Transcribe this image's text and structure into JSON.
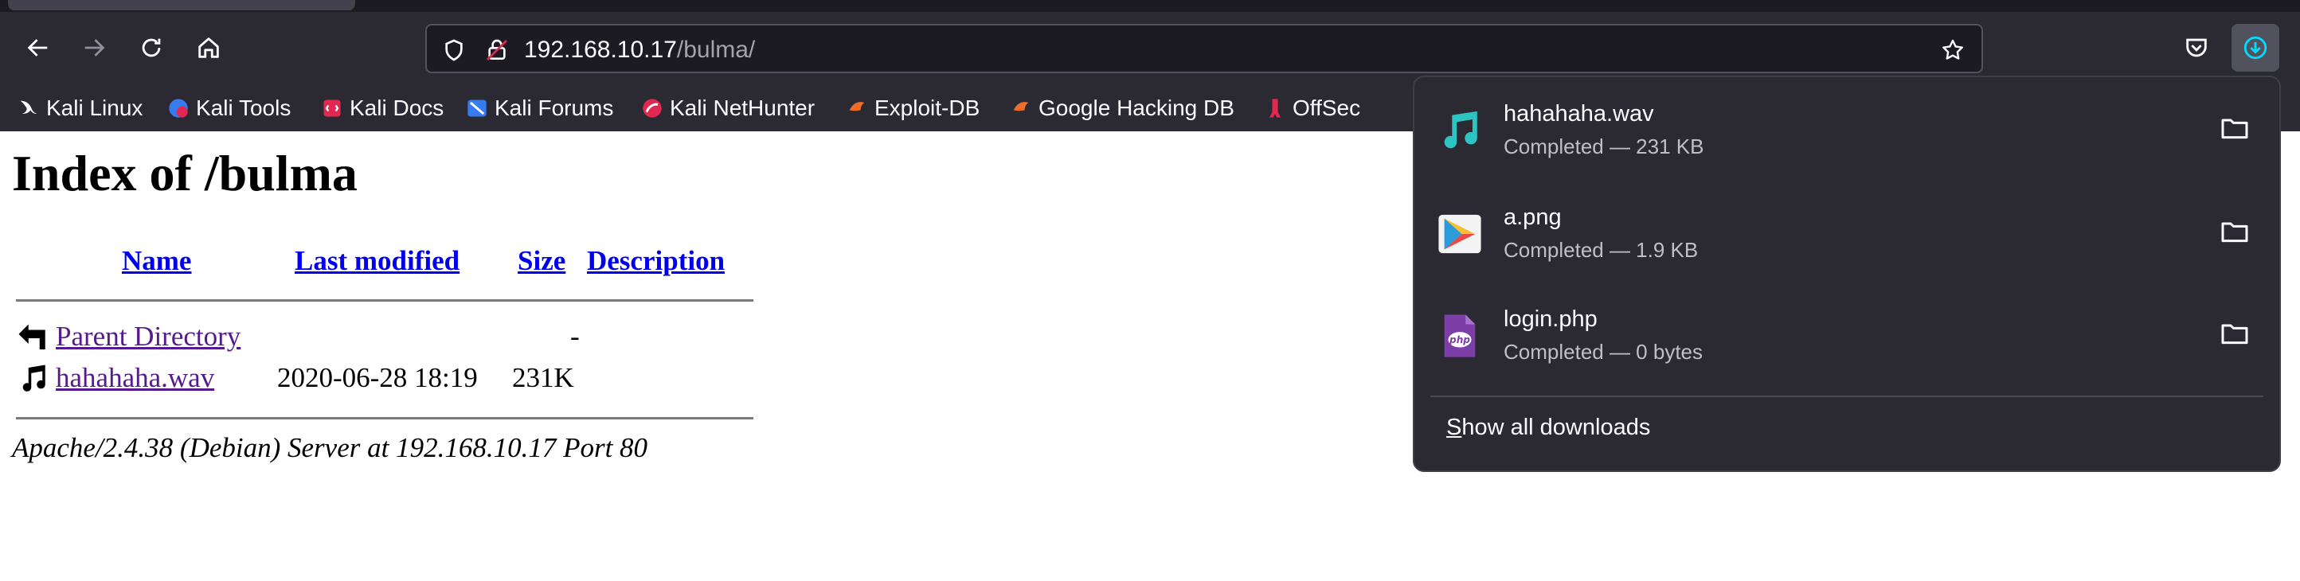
{
  "browser": {
    "url_host": "192.168.10.17",
    "url_path": "/bulma/",
    "bookmarks": [
      {
        "label": "Kali Linux",
        "icon": "kali-dragon-icon"
      },
      {
        "label": "Kali Tools",
        "icon": "kali-tools-icon"
      },
      {
        "label": "Kali Docs",
        "icon": "kali-docs-icon"
      },
      {
        "label": "Kali Forums",
        "icon": "kali-forums-icon"
      },
      {
        "label": "Kali NetHunter",
        "icon": "nethunter-icon"
      },
      {
        "label": "Exploit-DB",
        "icon": "exploit-db-icon"
      },
      {
        "label": "Google Hacking DB",
        "icon": "ghdb-icon"
      },
      {
        "label": "OffSec",
        "icon": "offsec-icon"
      }
    ]
  },
  "page": {
    "title": "Index of /bulma",
    "columns": {
      "name": "Name",
      "last_modified": "Last modified",
      "size": "Size",
      "description": "Description"
    },
    "rows": [
      {
        "name": "Parent Directory",
        "modified": "",
        "size": "-",
        "icon": "back-arrow-icon"
      },
      {
        "name": "hahahaha.wav",
        "modified": "2020-06-28 18:19",
        "size": "231K",
        "icon": "sound-icon"
      }
    ],
    "footer": "Apache/2.4.38 (Debian) Server at 192.168.10.17 Port 80"
  },
  "downloads": {
    "items": [
      {
        "name": "hahahaha.wav",
        "status": "Completed — 231 KB",
        "icon": "music-note-icon"
      },
      {
        "name": "a.png",
        "status": "Completed — 1.9 KB",
        "icon": "image-viewer-icon"
      },
      {
        "name": "login.php",
        "status": "Completed — 0 bytes",
        "icon": "php-file-icon"
      }
    ],
    "show_all_prefix": "S",
    "show_all_rest": "how all downloads"
  },
  "colors": {
    "toolbar": "#2b2a33",
    "link_visited": "#551a8b",
    "link": "#0000ee"
  }
}
